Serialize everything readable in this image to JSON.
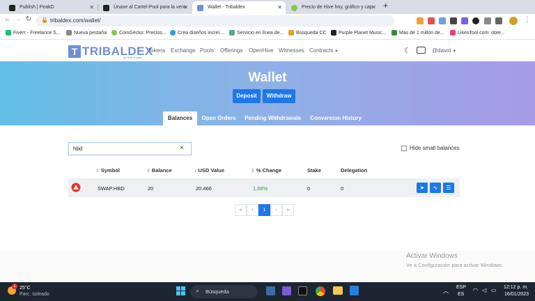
{
  "browser": {
    "tabs": [
      {
        "title": "Publish | PeakD"
      },
      {
        "title": "Únase al Cartel-Pool para la vent"
      },
      {
        "title": "Wallet - Tribaldex",
        "active": true
      },
      {
        "title": "Precio de Hive hoy, gráfico y cap"
      }
    ],
    "new_tab": "+",
    "url": "tribaldex.com/wallet/",
    "bookmarks": [
      "Fiverr - Freelance S...",
      "Nueva pestaña",
      "CoinGecko: Precios...",
      "Crea diseños increí...",
      "Servicio en línea de...",
      "Búsqueda CC",
      "Purple Planet Music...",
      "Más de 1 millón de...",
      "LikesTool.com: obte..."
    ]
  },
  "site": {
    "logo_text": "TRIBALDEX",
    "logo_mark": "T",
    "logo_sub": "by Hive-Engine",
    "nav": [
      "Tokens",
      "Exchange",
      "Pools",
      "Offerings",
      "OpenHive",
      "Witnesses",
      "Contracts"
    ],
    "user": "@davot"
  },
  "hero": {
    "title": "Wallet",
    "deposit_label": "Deposit",
    "withdraw_label": "Withdraw",
    "tabs": [
      "Balances",
      "Open Orders",
      "Pending Withdrawals",
      "Conversion History"
    ]
  },
  "search": {
    "value": "hbd",
    "clear": "×"
  },
  "hide_small": "Hide small balances",
  "table": {
    "headers": [
      "Symbol",
      "Balance",
      "USD Value",
      "% Change",
      "Stake",
      "Delegation"
    ],
    "rows": [
      {
        "symbol": "SWAP.HBD",
        "balance": "20",
        "usd": "20.466",
        "change": "1.68%",
        "stake": "0",
        "delegation": "0"
      }
    ]
  },
  "pagination": [
    "«",
    "‹",
    "1",
    "›",
    "»"
  ],
  "activation": {
    "line1": "Activar Windows",
    "line2": "Ve a Configuración para activar Windows."
  },
  "taskbar": {
    "weather_temp": "25°C",
    "weather_desc": "Parc. soleado",
    "weather_badge": "1",
    "search": "Búsqueda",
    "lang1": "ESP",
    "lang2": "ES",
    "time": "12:12 p. m.",
    "date": "16/01/2023"
  },
  "colors": {
    "accent": "#1e78e8",
    "positive": "#3a9a4a",
    "logo": "#6f8fd4"
  }
}
